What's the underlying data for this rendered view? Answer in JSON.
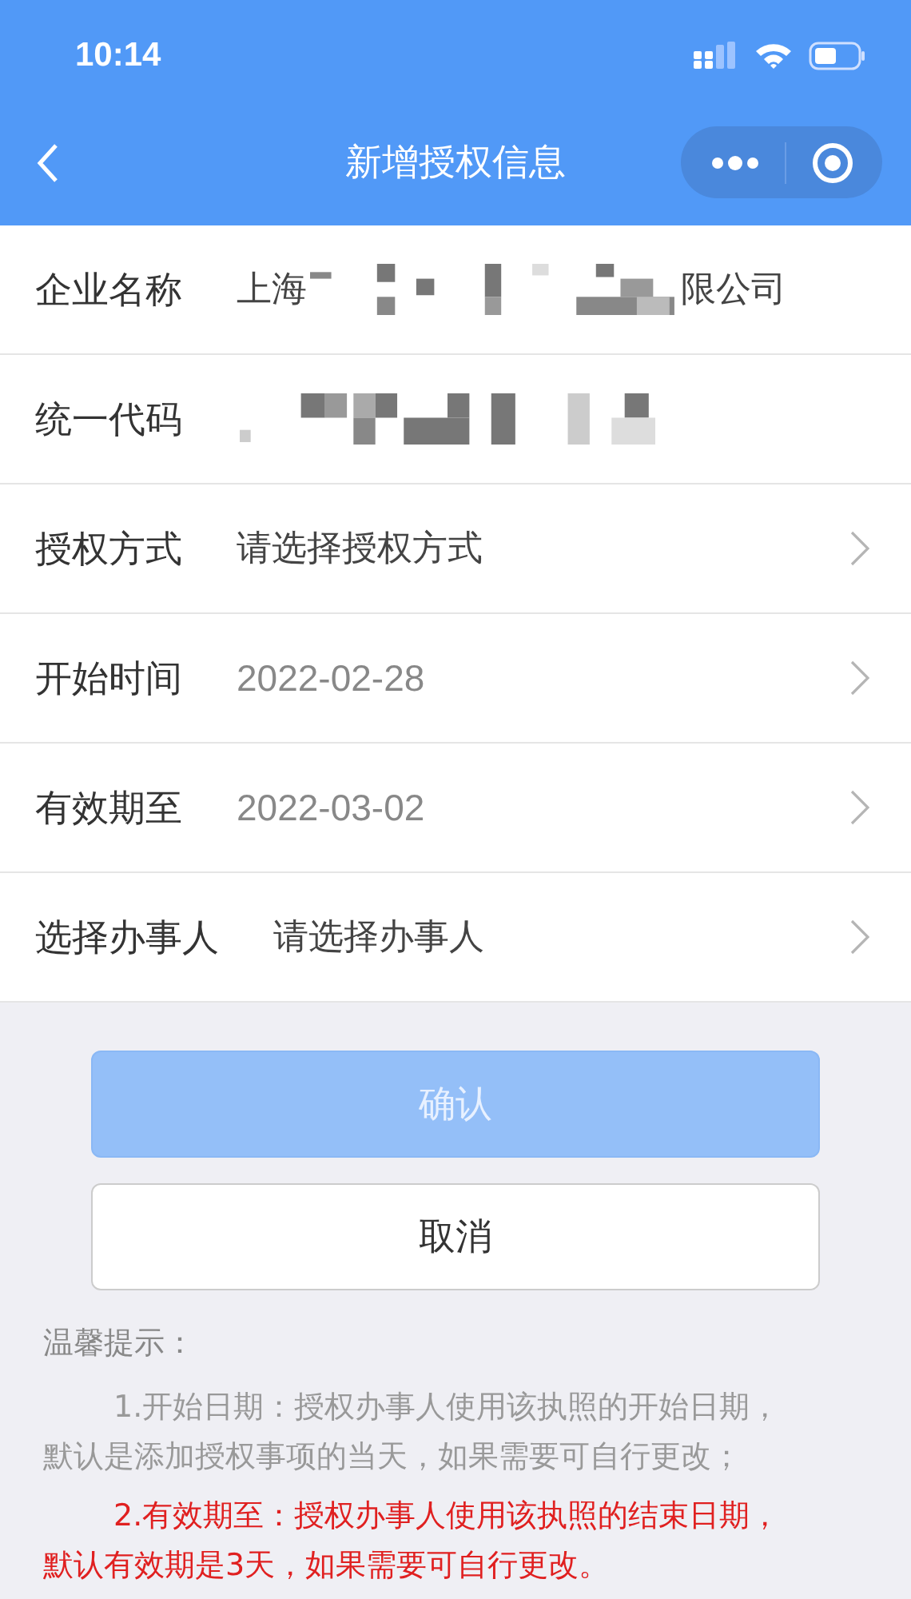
{
  "status_bar": {
    "time": "10:14"
  },
  "nav": {
    "title": "新增授权信息"
  },
  "fields": [
    {
      "label": "企业名称",
      "kind": "redacted",
      "parts": [
        "上海",
        "限公司"
      ]
    },
    {
      "label": "统一代码",
      "kind": "redacted"
    },
    {
      "label": "授权方式",
      "kind": "select",
      "placeholder": "请选择授权方式"
    },
    {
      "label": "开始时间",
      "kind": "select",
      "value": "2022-02-28"
    },
    {
      "label": "有效期至",
      "kind": "select",
      "value": "2022-03-02"
    },
    {
      "label": "选择办事人",
      "kind": "select",
      "placeholder": "请选择办事人"
    }
  ],
  "buttons": [
    {
      "label": "确认",
      "kind": "primary",
      "disabled": true
    },
    {
      "label": "取消",
      "kind": "secondary",
      "disabled": false
    }
  ],
  "tips": {
    "title": "温馨提示：",
    "items": [
      {
        "text": "1.开始日期：授权办事人使用该执照的开始日期，默认是添加授权事项的当天，如果需要可自行更改；",
        "highlighted": false
      },
      {
        "text": "2.有效期至：授权办事人使用该执照的结束日期，默认有效期是3天，如果需要可自行更改。",
        "highlighted": true
      }
    ]
  }
}
